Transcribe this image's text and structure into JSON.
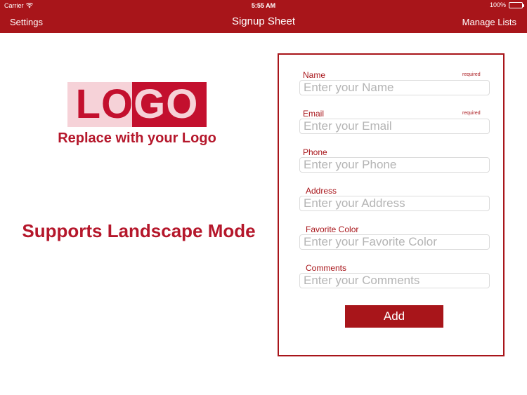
{
  "status_bar": {
    "carrier": "Carrier",
    "time": "5:55 AM",
    "battery": "100%"
  },
  "nav": {
    "left_label": "Settings",
    "title": "Signup Sheet",
    "right_label": "Manage Lists"
  },
  "logo": {
    "text_red": "LO",
    "text_pale": "GO",
    "caption": "Replace with your Logo"
  },
  "tagline": "Supports Landscape Mode",
  "form": {
    "fields": [
      {
        "label": "Name",
        "placeholder": "Enter your Name",
        "badge": "required"
      },
      {
        "label": "Email",
        "placeholder": "Enter your Email",
        "badge": "required"
      },
      {
        "label": "Phone",
        "placeholder": "Enter your Phone"
      },
      {
        "label": "Address",
        "placeholder": "Enter your Address"
      },
      {
        "label": "Favorite Color",
        "placeholder": "Enter your Favorite Color"
      },
      {
        "label": "Comments",
        "placeholder": "Enter your Comments"
      }
    ],
    "add_label": "Add"
  },
  "colors": {
    "accent": "#a8151a",
    "logo_red": "#c3102e",
    "logo_pale": "#f6d2d8"
  }
}
